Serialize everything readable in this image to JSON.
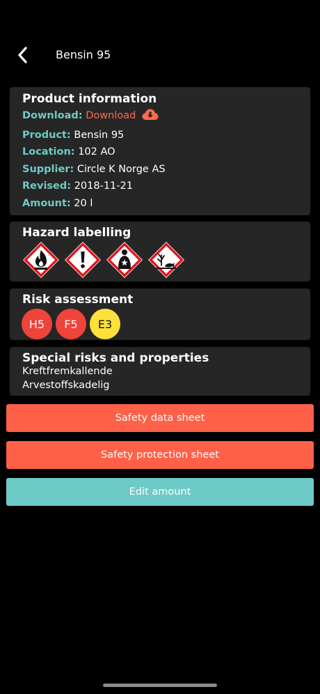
{
  "header": {
    "title": "Bensin 95"
  },
  "product_info": {
    "title": "Product information",
    "download_label": "Download:",
    "download_link": "Download",
    "rows": [
      {
        "key": "Product:",
        "value": "Bensin 95"
      },
      {
        "key": "Location:",
        "value": "102 AO"
      },
      {
        "key": "Supplier:",
        "value": "Circle K Norge AS"
      },
      {
        "key": "Revised:",
        "value": "2018-11-21"
      },
      {
        "key": "Amount:",
        "value": "20 l"
      }
    ]
  },
  "hazard": {
    "title": "Hazard labelling",
    "pictograms": [
      "flame-pictogram-icon",
      "exclamation-pictogram-icon",
      "health-hazard-pictogram-icon",
      "environment-pictogram-icon"
    ]
  },
  "risk": {
    "title": "Risk assessment",
    "badges": [
      {
        "label": "H5",
        "color": "#f0433a"
      },
      {
        "label": "F5",
        "color": "#f0433a"
      },
      {
        "label": "E3",
        "color": "#fde13a"
      }
    ]
  },
  "special": {
    "title": "Special risks and properties",
    "lines": [
      "Kreftfremkallende",
      "Arvestoffskadelig"
    ]
  },
  "buttons": {
    "safety_data_sheet": "Safety data sheet",
    "safety_protection_sheet": "Safety protection sheet",
    "edit_amount": "Edit amount"
  },
  "colors": {
    "accent_teal": "#6ecac6",
    "accent_coral": "#ff6a4a",
    "card_bg": "#262626"
  }
}
